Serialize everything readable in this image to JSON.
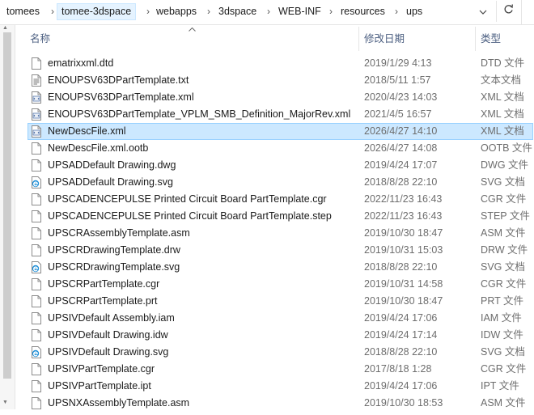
{
  "breadcrumb": [
    "tomees",
    "tomee-3dspace",
    "webapps",
    "3dspace",
    "WEB-INF",
    "resources",
    "ups"
  ],
  "columns": {
    "name": "名称",
    "date": "修改日期",
    "type": "类型"
  },
  "files": [
    {
      "name": "ematrixxml.dtd",
      "date": "2019/1/29 4:13",
      "type": "DTD 文件",
      "icon": "blank-file-icon"
    },
    {
      "name": "ENOUPSV63DPartTemplate.txt",
      "date": "2018/5/11 1:57",
      "type": "文本文档",
      "icon": "text-file-icon"
    },
    {
      "name": "ENOUPSV63DPartTemplate.xml",
      "date": "2020/4/23 14:03",
      "type": "XML 文档",
      "icon": "xml-file-icon"
    },
    {
      "name": "ENOUPSV63DPartTemplate_VPLM_SMB_Definition_MajorRev.xml",
      "date": "2021/4/5 16:57",
      "type": "XML 文档",
      "icon": "xml-file-icon"
    },
    {
      "name": "NewDescFile.xml",
      "date": "2026/4/27 14:10",
      "type": "XML 文档",
      "icon": "xml-file-icon",
      "selected": true
    },
    {
      "name": "NewDescFile.xml.ootb",
      "date": "2026/4/27 14:08",
      "type": "OOTB 文件",
      "icon": "blank-file-icon"
    },
    {
      "name": "UPSADDefault Drawing.dwg",
      "date": "2019/4/24 17:07",
      "type": "DWG 文件",
      "icon": "blank-file-icon"
    },
    {
      "name": "UPSADDefault Drawing.svg",
      "date": "2018/8/28 22:10",
      "type": "SVG 文档",
      "icon": "edge-svg-icon"
    },
    {
      "name": "UPSCADENCEPULSE Printed Circuit Board PartTemplate.cgr",
      "date": "2022/11/23 16:43",
      "type": "CGR 文件",
      "icon": "blank-file-icon"
    },
    {
      "name": "UPSCADENCEPULSE Printed Circuit Board PartTemplate.step",
      "date": "2022/11/23 16:43",
      "type": "STEP 文件",
      "icon": "blank-file-icon"
    },
    {
      "name": "UPSCRAssemblyTemplate.asm",
      "date": "2019/10/30 18:47",
      "type": "ASM 文件",
      "icon": "blank-file-icon"
    },
    {
      "name": "UPSCRDrawingTemplate.drw",
      "date": "2019/10/31 15:03",
      "type": "DRW 文件",
      "icon": "blank-file-icon"
    },
    {
      "name": "UPSCRDrawingTemplate.svg",
      "date": "2018/8/28 22:10",
      "type": "SVG 文档",
      "icon": "edge-svg-icon"
    },
    {
      "name": "UPSCRPartTemplate.cgr",
      "date": "2019/10/31 14:58",
      "type": "CGR 文件",
      "icon": "blank-file-icon"
    },
    {
      "name": "UPSCRPartTemplate.prt",
      "date": "2019/10/30 18:47",
      "type": "PRT 文件",
      "icon": "blank-file-icon"
    },
    {
      "name": "UPSIVDefault Assembly.iam",
      "date": "2019/4/24 17:06",
      "type": "IAM 文件",
      "icon": "blank-file-icon"
    },
    {
      "name": "UPSIVDefault Drawing.idw",
      "date": "2019/4/24 17:14",
      "type": "IDW 文件",
      "icon": "blank-file-icon"
    },
    {
      "name": "UPSIVDefault Drawing.svg",
      "date": "2018/8/28 22:10",
      "type": "SVG 文档",
      "icon": "edge-svg-icon"
    },
    {
      "name": "UPSIVPartTemplate.cgr",
      "date": "2017/8/18 1:28",
      "type": "CGR 文件",
      "icon": "blank-file-icon"
    },
    {
      "name": "UPSIVPartTemplate.ipt",
      "date": "2019/4/24 17:06",
      "type": "IPT 文件",
      "icon": "blank-file-icon"
    },
    {
      "name": "UPSNXAssemblyTemplate.asm",
      "date": "2019/10/30 18:53",
      "type": "ASM 文件",
      "icon": "blank-file-icon"
    }
  ],
  "colors": {
    "selected_bg": "#cce8ff",
    "selected_border": "#99d1ff",
    "header_text": "#4d6082",
    "meta_text": "#6d6d6d",
    "crumb_highlight": "#e5f3ff"
  }
}
